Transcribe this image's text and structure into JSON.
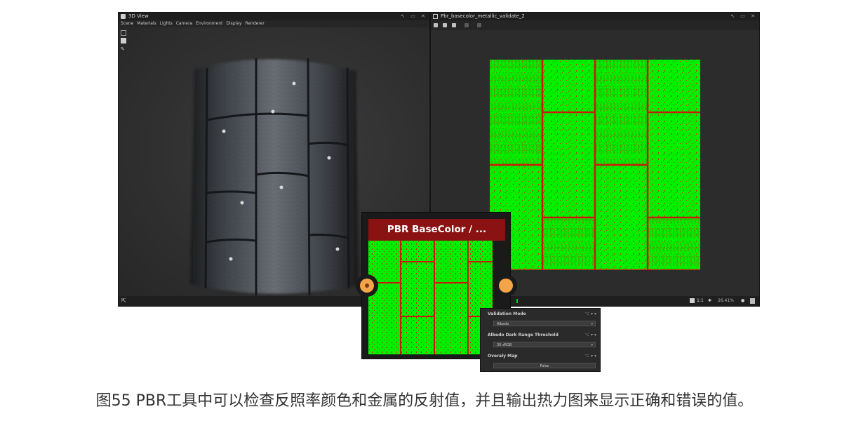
{
  "left_window": {
    "title": "3D View",
    "menu": [
      "Scene",
      "Materials",
      "Lights",
      "Camera",
      "Environment",
      "Display",
      "Renderer"
    ],
    "status": "⇱"
  },
  "right_window": {
    "title": "Pbr_basecolor_metallic_validate_2",
    "status_zoom": "26.41%",
    "status_ratio": "1:1"
  },
  "window_controls": "↖ ▭ ✕",
  "node": {
    "title": "PBR BaseColor / ..."
  },
  "properties": {
    "rows": [
      {
        "label": "Validation Mode",
        "value": "Albedo"
      },
      {
        "label": "Albedo Dark Range Threshold",
        "value": "30 sRGB"
      },
      {
        "label": "Overaly Map",
        "value": "False"
      }
    ]
  },
  "caption": "图55 PBR工具中可以检查反照率颜色和金属的反射值，并且输出热力图来显示正确和错误的值。",
  "colors": {
    "valid": "#00ee00",
    "invalid": "#cc1a0a",
    "node_header": "#8b1212",
    "port": "#f5a44a"
  }
}
